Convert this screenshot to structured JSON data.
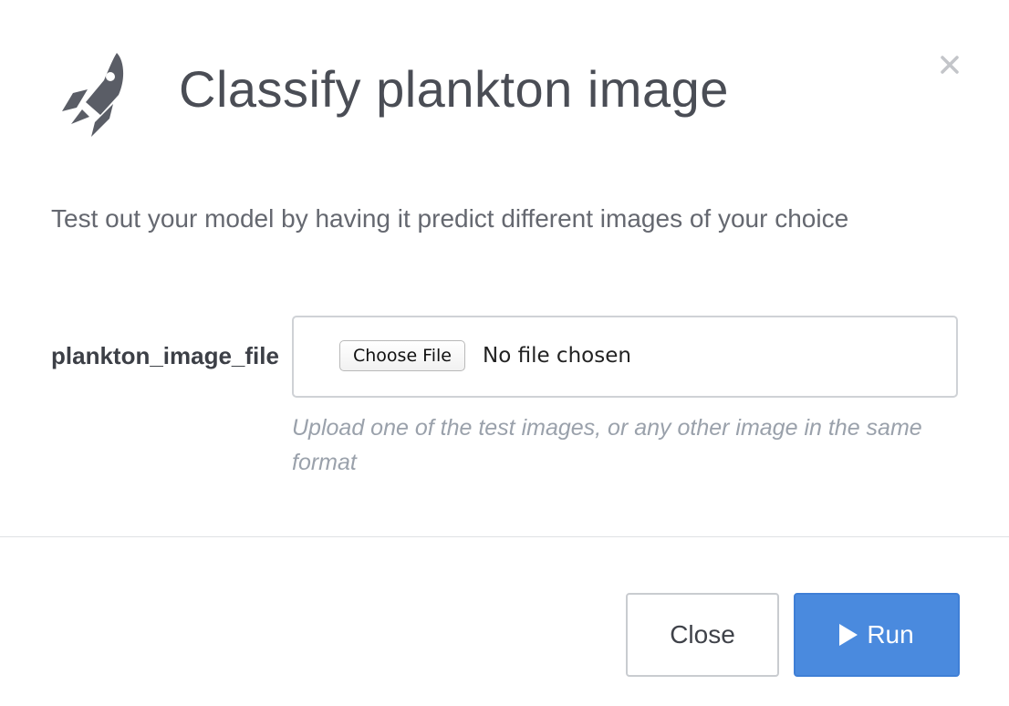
{
  "dialog": {
    "title": "Classify plankton image",
    "subtitle": "Test out your model by having it predict different images of your choice",
    "close_icon": "close-icon",
    "header_icon": "rocket-icon"
  },
  "form": {
    "field_label": "plankton_image_file",
    "choose_file_label": "Choose File",
    "file_status": "No file chosen",
    "help_text": "Upload one of the test images, or any other image in the same format"
  },
  "footer": {
    "close_label": "Close",
    "run_label": "Run",
    "run_icon": "play-icon"
  },
  "colors": {
    "primary": "#4a8ade",
    "title_text": "#4a4d55",
    "icon": "#5a5d66",
    "help_text": "#9aa1ab"
  }
}
